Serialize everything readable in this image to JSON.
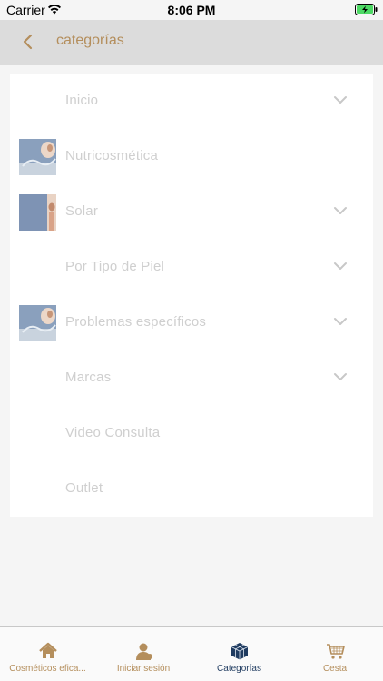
{
  "status_bar": {
    "carrier": "Carrier",
    "time": "8:06 PM",
    "icons": [
      "wifi-icon",
      "battery-charging-icon"
    ]
  },
  "nav": {
    "title": "categorías",
    "back_icon": "chevron-left-icon"
  },
  "menu": {
    "items": [
      {
        "label": "Inicio",
        "has_thumb": false,
        "has_chevron": true
      },
      {
        "label": "Nutricosmética",
        "has_thumb": true,
        "has_chevron": false
      },
      {
        "label": "Solar",
        "has_thumb": true,
        "has_chevron": true
      },
      {
        "label": "Por Tipo de Piel",
        "has_thumb": false,
        "has_chevron": true
      },
      {
        "label": "Problemas específicos",
        "has_thumb": true,
        "has_chevron": true
      },
      {
        "label": "Marcas",
        "has_thumb": false,
        "has_chevron": true
      },
      {
        "label": "Video Consulta",
        "has_thumb": false,
        "has_chevron": false
      },
      {
        "label": "Outlet",
        "has_thumb": false,
        "has_chevron": false
      }
    ]
  },
  "tabs": [
    {
      "label": "Cosméticos efica...",
      "icon": "home-icon",
      "active": false
    },
    {
      "label": "Iniciar sesión",
      "icon": "user-icon",
      "active": false
    },
    {
      "label": "Categorías",
      "icon": "cube-icon",
      "active": true
    },
    {
      "label": "Cesta",
      "icon": "cart-icon",
      "active": false
    }
  ],
  "colors": {
    "accent": "#b48e5c",
    "active_tab": "#1e3a5f",
    "nav_bg": "#dcdcdc",
    "menu_text": "#cfcfcf"
  }
}
